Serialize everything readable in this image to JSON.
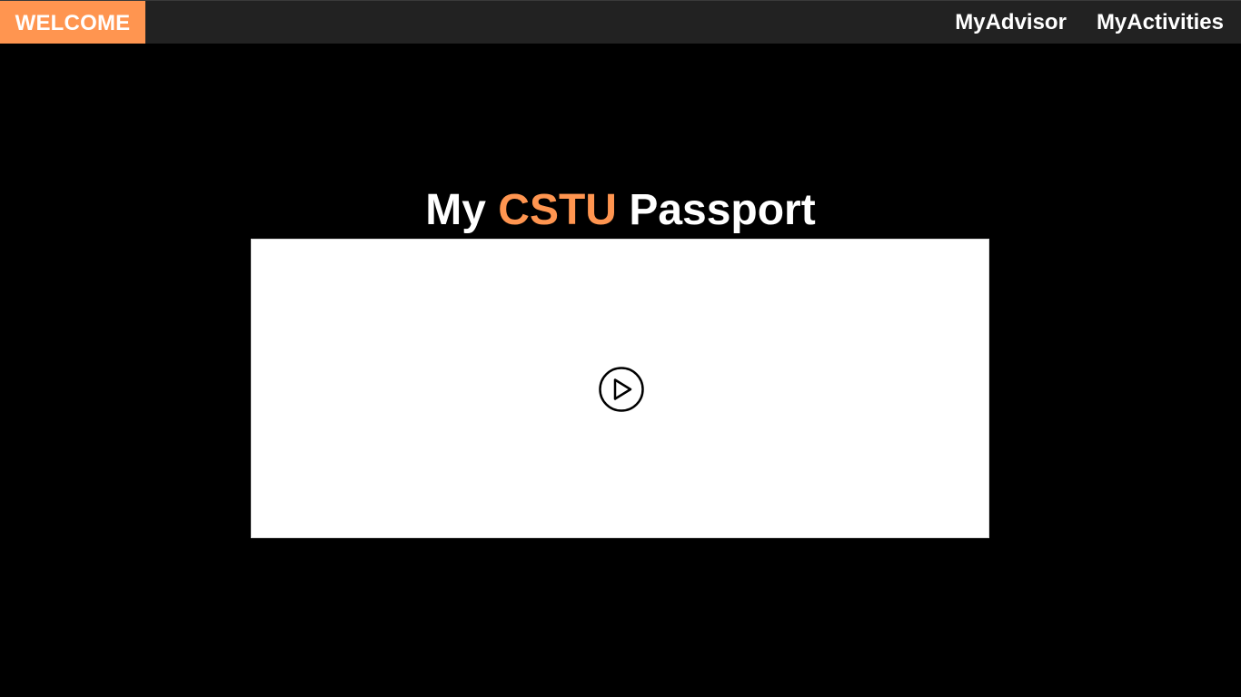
{
  "topbar": {
    "welcome_label": "WELCOME",
    "nav": {
      "my_advisor": "MyAdvisor",
      "my_activities": "MyActivities"
    }
  },
  "main": {
    "title_part1": "My",
    "title_accent": "CSTU",
    "title_part2": "Passport"
  },
  "video": {
    "play_icon": "play-circle-icon"
  },
  "colors": {
    "accent": "#ff9550",
    "topbar_bg": "#222222",
    "page_bg": "#000000",
    "video_bg": "#ffffff"
  }
}
